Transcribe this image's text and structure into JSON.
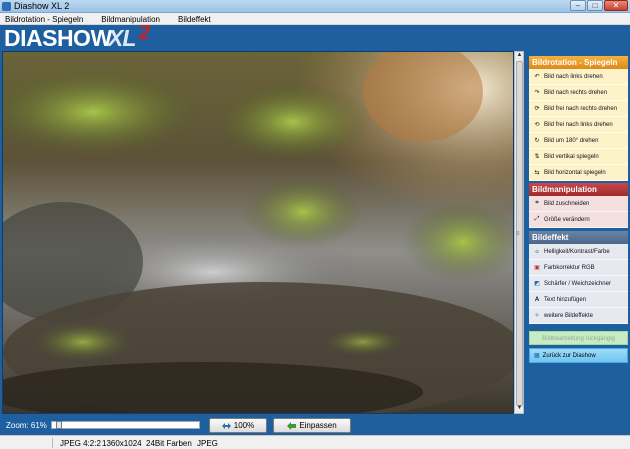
{
  "window": {
    "title": "Diashow XL 2"
  },
  "menu": [
    "Bildrotation - Spiegeln",
    "Bildmanipulation",
    "Bildeffekt"
  ],
  "logo": {
    "main": "DIASHOW",
    "xl": "XL",
    "num": "2"
  },
  "zoom": {
    "label": "Zoom: 61%",
    "level": 0.61,
    "btn_100": "100%",
    "btn_fit": "Einpassen"
  },
  "status": {
    "format": "JPEG 4:2:2",
    "size": "1360x1024",
    "colors": "24Bit Farben",
    "type": "JPEG"
  },
  "panel": {
    "rotation": {
      "title": "Bildrotation - Spiegeln",
      "items": [
        {
          "label": "Bild nach links drehen",
          "icon": "rotate-left-icon"
        },
        {
          "label": "Bild nach rechts drehen",
          "icon": "rotate-right-icon"
        },
        {
          "label": "Bild frei nach rechts drehen",
          "icon": "free-rotate-right-icon"
        },
        {
          "label": "Bild frei nach links drehen",
          "icon": "free-rotate-left-icon"
        },
        {
          "label": "Bild um 180° drehen",
          "icon": "rotate-180-icon"
        },
        {
          "label": "Bild vertikal spiegeln",
          "icon": "flip-vertical-icon"
        },
        {
          "label": "Bild horizontal spiegeln",
          "icon": "flip-horizontal-icon"
        }
      ]
    },
    "manipulation": {
      "title": "Bildmanipulation",
      "items": [
        {
          "label": "Bild zuschneiden",
          "icon": "crop-icon"
        },
        {
          "label": "Größe verändern",
          "icon": "resize-icon"
        }
      ]
    },
    "effects": {
      "title": "Bildeffekt",
      "items": [
        {
          "label": "Helligkeit/Kontrast/Farbe",
          "icon": "brightness-icon"
        },
        {
          "label": "Farbkorrektur RGB",
          "icon": "rgb-icon"
        },
        {
          "label": "Schärfer / Weichzeichner",
          "icon": "sharpen-icon"
        },
        {
          "label": "Text hinzufügen",
          "icon": "text-icon"
        },
        {
          "label": "weitere Bildeffekte",
          "icon": "effects-icon"
        }
      ]
    },
    "undo_label": "Bildbearbeitung rückgängig",
    "back_label": "Zurück zur Diashow"
  },
  "colors": {
    "accent": "#1d5f9f",
    "orange": "#e1881a",
    "red": "#a22b2d",
    "slate": "#4c6788"
  }
}
